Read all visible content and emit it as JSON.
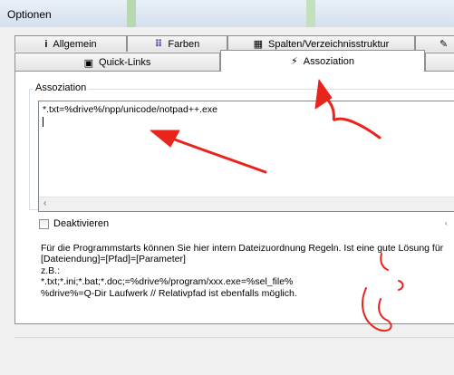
{
  "window": {
    "title": "Optionen"
  },
  "tabs_row1": [
    {
      "label": "Allgemein",
      "icon": "info-icon",
      "glyph": "i"
    },
    {
      "label": "Farben",
      "icon": "palette-icon",
      "glyph": "⠿"
    },
    {
      "label": "Spalten/Verzeichnisstruktur",
      "icon": "columns-icon",
      "glyph": "▦"
    },
    {
      "label": "",
      "icon": "brush-icon",
      "glyph": "✎"
    }
  ],
  "tabs_row2": [
    {
      "label": "Quick-Links",
      "icon": "quicklinks-icon",
      "glyph": "▣"
    },
    {
      "label": "Assoziation",
      "icon": "association-icon",
      "glyph": "⚡",
      "active": true
    },
    {
      "label": "",
      "icon": "",
      "glyph": ""
    }
  ],
  "group": {
    "title": "Assoziation"
  },
  "editor": {
    "text": "*.txt=%drive%/npp/unicode/notpad++.exe"
  },
  "checkbox": {
    "label": "Deaktivieren",
    "checked": false
  },
  "help_lines": [
    "Für die Programmstarts können Sie hier intern Dateizuordnung Regeln. Ist eine gute Lösung für",
    "[Dateiendung]=[Pfad]=[Parameter]",
    "z.B.:",
    "*.txt;*.ini;*.bat;*.doc;=%drive%/program/xxx.exe=%sel_file%",
    "%drive%=Q-Dir Laufwerk // Relativpfad ist ebenfalls möglich."
  ],
  "colors": {
    "annotation": "#e8241c",
    "title_bg": "#dde7f2",
    "border": "#8e8f8f"
  }
}
